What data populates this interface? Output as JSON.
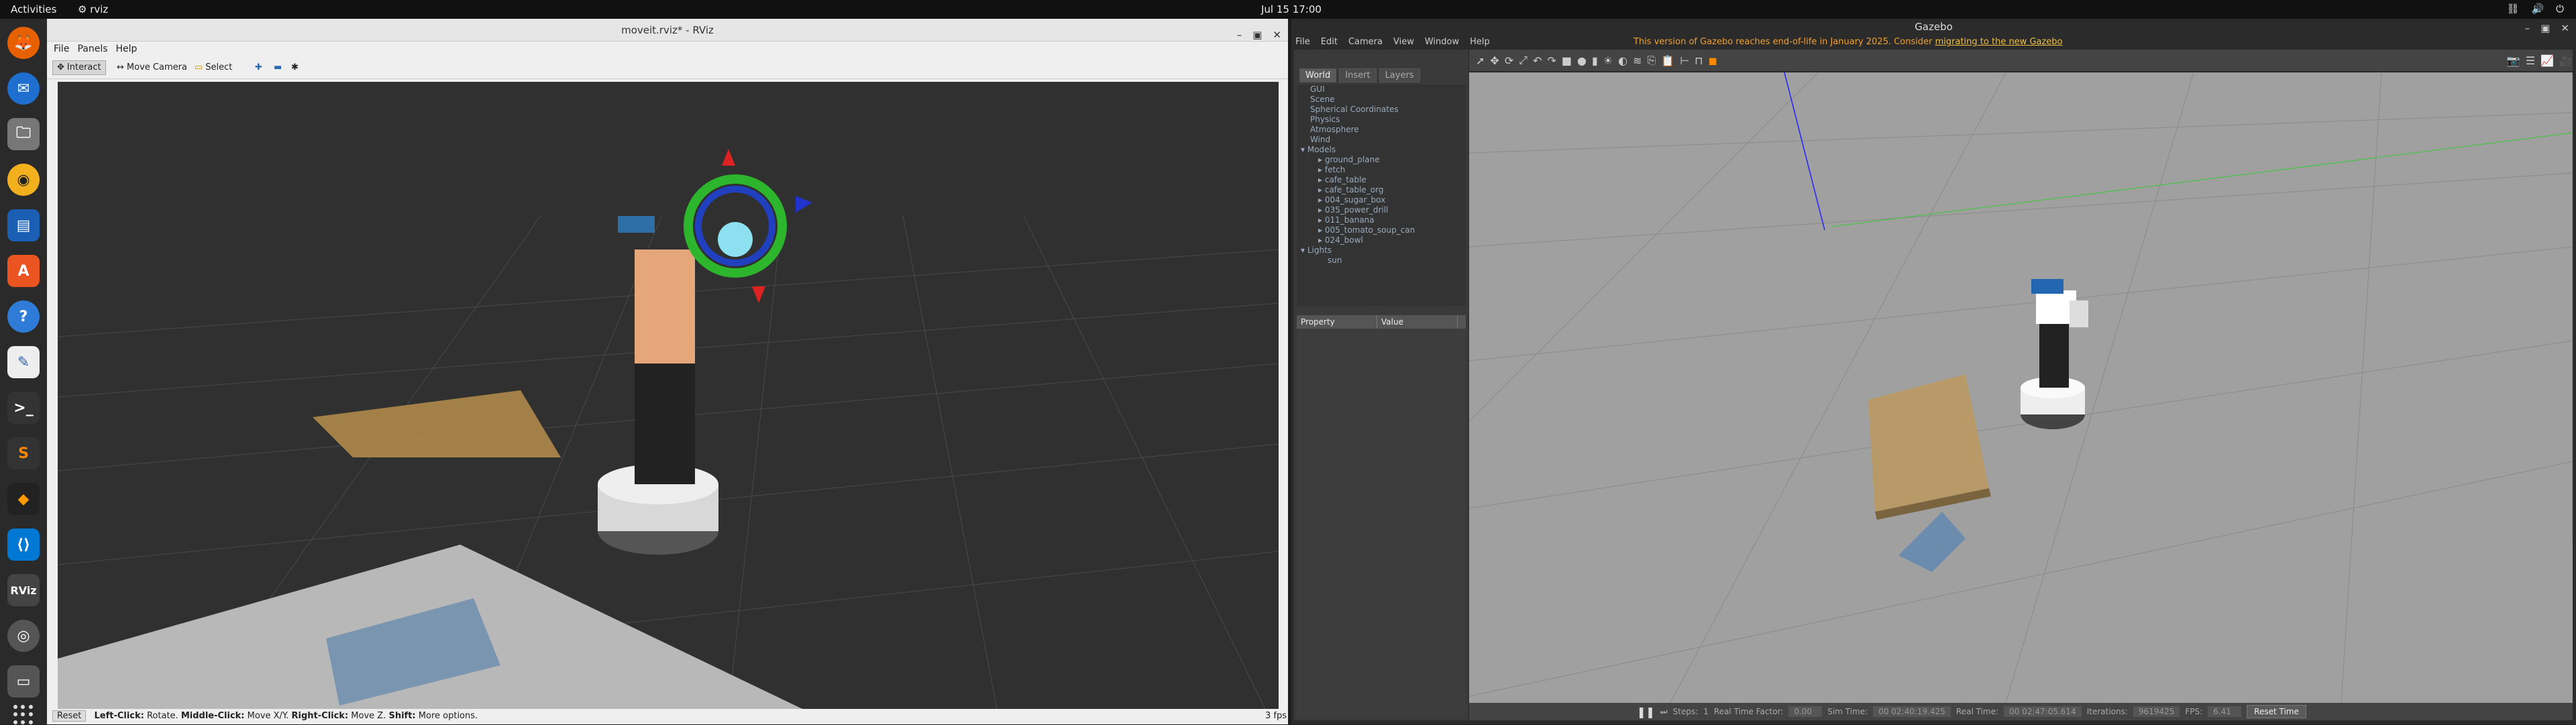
{
  "topbar": {
    "activities": "Activities",
    "app": "rviz",
    "clock": "Jul 15  17:00"
  },
  "rviz": {
    "title": "moveit.rviz* - RViz",
    "menu": [
      "File",
      "Panels",
      "Help"
    ],
    "tools": {
      "interact": "Interact",
      "move_camera": "Move Camera",
      "select": "Select"
    },
    "status": {
      "reset": "Reset",
      "left": "Left-Click:",
      "left_desc": "Rotate.",
      "middle": "Middle-Click:",
      "middle_desc": "Move X/Y.",
      "right": "Right-Click:",
      "right_desc": "Move Z.",
      "shift": "Shift:",
      "shift_desc": "More options."
    },
    "fps": "3 fps"
  },
  "gazebo": {
    "title": "Gazebo",
    "menu": [
      "File",
      "Edit",
      "Camera",
      "View",
      "Window",
      "Help"
    ],
    "banner_text": "This version of Gazebo reaches end-of-life in January 2025. Consider ",
    "banner_link": "migrating to the new Gazebo",
    "tabs": [
      "World",
      "Insert",
      "Layers"
    ],
    "tree": [
      "GUI",
      "Scene",
      "Spherical Coordinates",
      "Physics",
      "Atmosphere",
      "Wind",
      "Models",
      "ground_plane",
      "fetch",
      "cafe_table",
      "cafe_table_org",
      "004_sugar_box",
      "035_power_drill",
      "011_banana",
      "005_tomato_soup_can",
      "024_bowl",
      "Lights",
      "sun"
    ],
    "property_header": {
      "property": "Property",
      "value": "Value"
    },
    "bottom": {
      "steps_label": "Steps:",
      "steps_value": "1",
      "rtf_label": "Real Time Factor:",
      "rtf_value": "0.00",
      "sim_label": "Sim Time:",
      "sim_value": "00 02:40:19.425",
      "real_label": "Real Time:",
      "real_value": "00 02:47:05.614",
      "iter_label": "Iterations:",
      "iter_value": "9619425",
      "fps_label": "FPS:",
      "fps_value": "6.41",
      "reset_time": "Reset Time"
    }
  }
}
